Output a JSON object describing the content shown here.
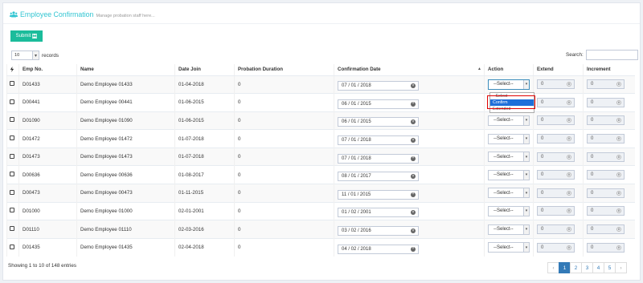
{
  "header": {
    "title": "Employee Confirmation",
    "subtitle": "Manage probation staff here..."
  },
  "submit_label": "Submit",
  "length_menu": {
    "value": "10",
    "suffix": "records"
  },
  "search": {
    "label": "Search:",
    "value": ""
  },
  "columns": [
    "",
    "Emp No.",
    "Name",
    "Date Join",
    "Probation Duration",
    "Confirmation Date",
    "Action",
    "Extend",
    "Increment"
  ],
  "rows": [
    {
      "emp": "D01433",
      "name": "Demo Employee 01433",
      "join": "01-04-2018",
      "duration": "0",
      "conf": "07 / 01 / 2018",
      "action": "--Select--",
      "extend": "0",
      "increment": "0"
    },
    {
      "emp": "D00441",
      "name": "Demo Employee 00441",
      "join": "01-06-2015",
      "duration": "0",
      "conf": "06 / 01 / 2015",
      "action": "--Select--",
      "extend": "0",
      "increment": "0"
    },
    {
      "emp": "D01090",
      "name": "Demo Employee 01090",
      "join": "01-06-2015",
      "duration": "0",
      "conf": "06 / 01 / 2015",
      "action": "--Select--",
      "extend": "0",
      "increment": "0"
    },
    {
      "emp": "D01472",
      "name": "Demo Employee 01472",
      "join": "01-07-2018",
      "duration": "0",
      "conf": "07 / 01 / 2018",
      "action": "--Select--",
      "extend": "0",
      "increment": "0"
    },
    {
      "emp": "D01473",
      "name": "Demo Employee 01473",
      "join": "01-07-2018",
      "duration": "0",
      "conf": "07 / 01 / 2018",
      "action": "--Select--",
      "extend": "0",
      "increment": "0"
    },
    {
      "emp": "D00636",
      "name": "Demo Employee 00636",
      "join": "01-08-2017",
      "duration": "0",
      "conf": "08 / 01 / 2017",
      "action": "--Select--",
      "extend": "0",
      "increment": "0"
    },
    {
      "emp": "D00473",
      "name": "Demo Employee 00473",
      "join": "01-11-2015",
      "duration": "0",
      "conf": "11 / 01 / 2015",
      "action": "--Select--",
      "extend": "0",
      "increment": "0"
    },
    {
      "emp": "D01000",
      "name": "Demo Employee 01000",
      "join": "02-01-2001",
      "duration": "0",
      "conf": "01 / 02 / 2001",
      "action": "--Select--",
      "extend": "0",
      "increment": "0"
    },
    {
      "emp": "D01110",
      "name": "Demo Employee 01110",
      "join": "02-03-2016",
      "duration": "0",
      "conf": "03 / 02 / 2016",
      "action": "--Select--",
      "extend": "0",
      "increment": "0"
    },
    {
      "emp": "D01435",
      "name": "Demo Employee 01435",
      "join": "02-04-2018",
      "duration": "0",
      "conf": "04 / 02 / 2018",
      "action": "--Select--",
      "extend": "0",
      "increment": "0"
    }
  ],
  "action_dropdown": {
    "options": [
      "--Select--",
      "Confirm",
      "Extended"
    ],
    "highlighted": "Confirm"
  },
  "footer": {
    "info": "Showing 1 to 10 of 148 entries"
  },
  "pagination": {
    "prev": "‹",
    "pages": [
      "1",
      "2",
      "3",
      "4",
      "5"
    ],
    "active": "1",
    "next": "›"
  },
  "colors": {
    "title": "#32c5d2",
    "submit": "#1bbc9b",
    "active_page": "#337ab7",
    "highlight_box": "#e00000",
    "dropdown_selected": "#1e6fd9"
  }
}
